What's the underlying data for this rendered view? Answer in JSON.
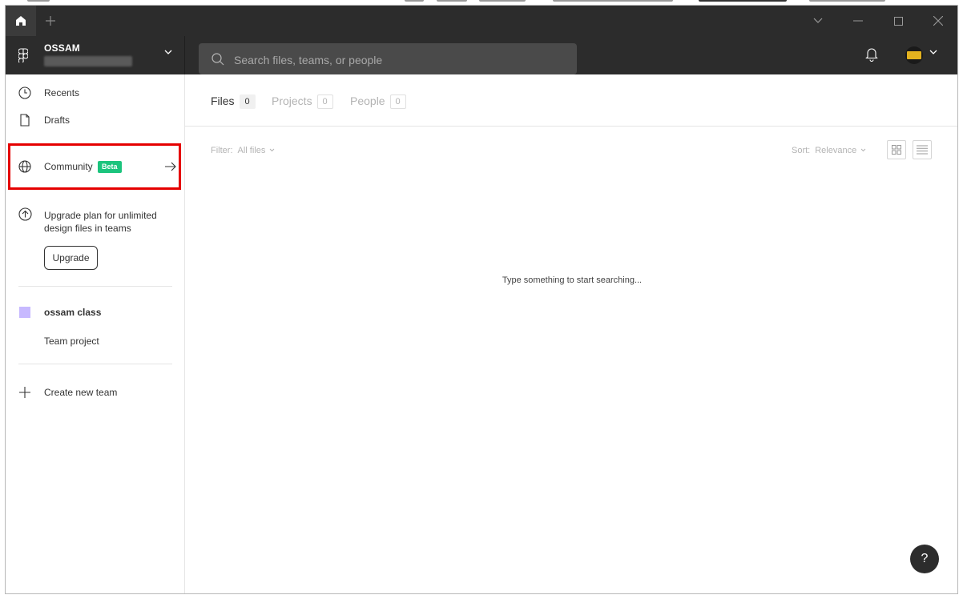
{
  "colors": {
    "chrome_dark": "#2c2c2c",
    "accent_green": "#1bc47d",
    "highlight_red": "#e50000",
    "team_swatch": "#c7b9ff"
  },
  "window": {
    "controls": [
      "chevron-down-icon",
      "minimize-icon",
      "maximize-icon",
      "close-icon"
    ]
  },
  "header": {
    "team_name": "OSSAM",
    "search_placeholder": "Search files, teams, or people",
    "icons": [
      "figma-logo-icon",
      "search-icon",
      "bell-icon",
      "avatar"
    ]
  },
  "sidebar": {
    "recents": "Recents",
    "drafts": "Drafts",
    "community": "Community",
    "community_badge": "Beta",
    "upgrade_text": "Upgrade plan for unlimited design files in teams",
    "upgrade_button": "Upgrade",
    "team_name": "ossam class",
    "team_project": "Team project",
    "create_team": "Create new team"
  },
  "main": {
    "tabs": [
      {
        "label": "Files",
        "count": "0"
      },
      {
        "label": "Projects",
        "count": "0"
      },
      {
        "label": "People",
        "count": "0"
      }
    ],
    "filter_label": "Filter:",
    "filter_value": "All files",
    "sort_label": "Sort:",
    "sort_value": "Relevance",
    "empty_message": "Type something to start searching...",
    "help_label": "?"
  }
}
